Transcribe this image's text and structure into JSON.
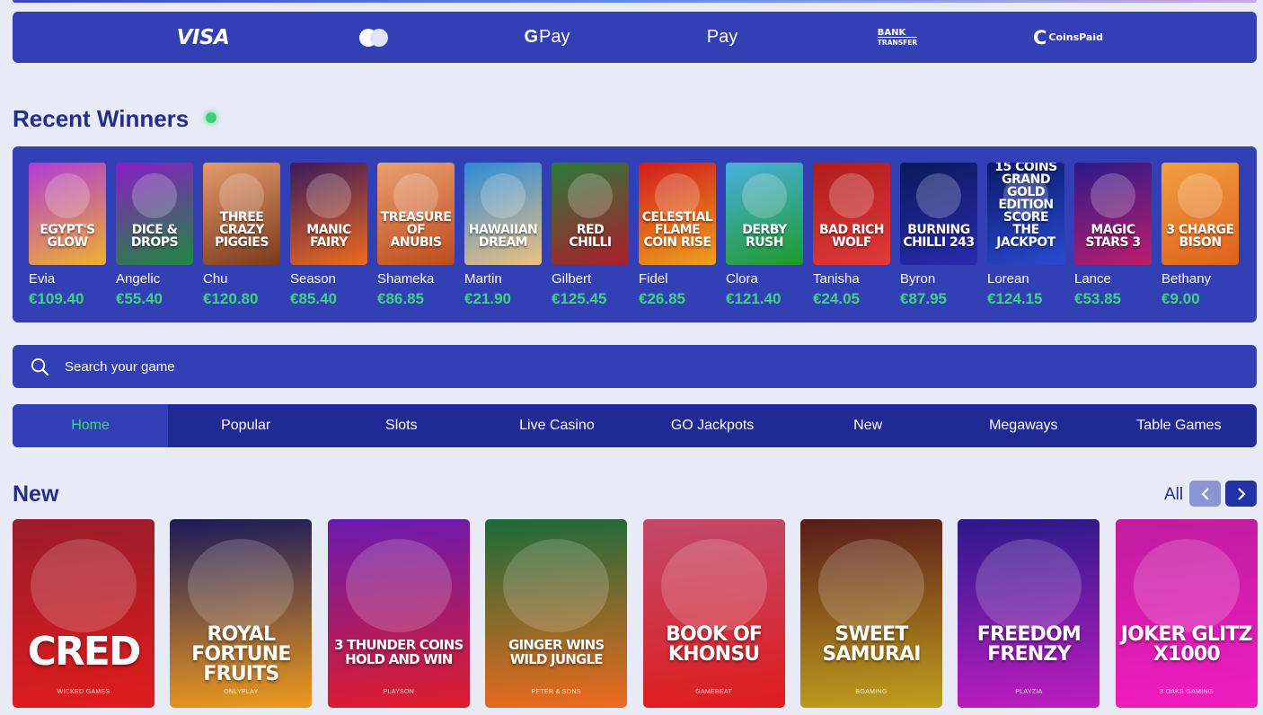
{
  "payments": {
    "visa": "VISA",
    "gpay_g": "G",
    "gpay_text": "Pay",
    "apple_glyph": "",
    "apay_text": "Pay",
    "bank_line1": "BANK",
    "bank_line2": "TRANSFER",
    "coinspaid_glyph": "C",
    "coinspaid_text": "CoinsPaid"
  },
  "recent_winners": {
    "title": "Recent Winners",
    "items": [
      {
        "game": "Egypt's Glow",
        "player": "Evia",
        "amount": "€109.40",
        "color_a": "#b03bd6",
        "color_b": "#f0b030"
      },
      {
        "game": "Dice & Drops",
        "player": "Angelic",
        "amount": "€55.40",
        "color_a": "#8a1cc9",
        "color_b": "#1f8a3b"
      },
      {
        "game": "Three Crazy Piggies",
        "player": "Chu",
        "amount": "€120.80",
        "color_a": "#e59a6a",
        "color_b": "#7a3a1c"
      },
      {
        "game": "Manic Fairy",
        "player": "Season",
        "amount": "€85.40",
        "color_a": "#3a1a5a",
        "color_b": "#f06a1c"
      },
      {
        "game": "Treasure of Anubis",
        "player": "Shameka",
        "amount": "€86.85",
        "color_a": "#e8a070",
        "color_b": "#c04a1c"
      },
      {
        "game": "Hawaiian Dream",
        "player": "Martin",
        "amount": "€21.90",
        "color_a": "#2a8ad8",
        "color_b": "#f0c080"
      },
      {
        "game": "Red Chilli",
        "player": "Gilbert",
        "amount": "€125.45",
        "color_a": "#2a7a3a",
        "color_b": "#b01c2a"
      },
      {
        "game": "Celestial Flame Coin Rise",
        "player": "Fidel",
        "amount": "€26.85",
        "color_a": "#d01c1c",
        "color_b": "#f0a01c"
      },
      {
        "game": "Derby Rush",
        "player": "Clora",
        "amount": "€121.40",
        "color_a": "#4ab0e0",
        "color_b": "#1f9a2a"
      },
      {
        "game": "Bad Rich Wolf",
        "player": "Tanisha",
        "amount": "€24.05",
        "color_a": "#b01c1c",
        "color_b": "#e03a3a"
      },
      {
        "game": "Burning Chilli 243",
        "player": "Byron",
        "amount": "€87.95",
        "color_a": "#0a1a5a",
        "color_b": "#2a2ab0"
      },
      {
        "game": "15 Coins Grand Gold Edition Score the Jackpot",
        "player": "Lorean",
        "amount": "€124.15",
        "color_a": "#0a1a6a",
        "color_b": "#2a4ad0"
      },
      {
        "game": "Magic Stars 3",
        "player": "Lance",
        "amount": "€53.85",
        "color_a": "#2a1a8a",
        "color_b": "#c01c6a"
      },
      {
        "game": "3 Charge Bison",
        "player": "Bethany",
        "amount": "€9.00",
        "color_a": "#f0a040",
        "color_b": "#e0601c"
      }
    ]
  },
  "search": {
    "placeholder": "Search your game"
  },
  "tabs": [
    "Home",
    "Popular",
    "Slots",
    "Live Casino",
    "GO Jackpots",
    "New",
    "Megaways",
    "Table Games"
  ],
  "new_section": {
    "title": "New",
    "all_label": "All",
    "games": [
      {
        "title": "Cred",
        "provider": "Wicked Games",
        "color_a": "#9a1c2a",
        "color_b": "#e01c1c",
        "size": "big"
      },
      {
        "title": "Royal Fortune Fruits",
        "provider": "OnlyPlay",
        "color_a": "#1a1a5a",
        "color_b": "#f09a1c",
        "size": "normal"
      },
      {
        "title": "3 Thunder Coins Hold and Win",
        "provider": "Playson",
        "color_a": "#6a1ab0",
        "color_b": "#e01c2a",
        "size": "small"
      },
      {
        "title": "Ginger Wins Wild Jungle",
        "provider": "Peter & Sons",
        "color_a": "#1a6a3a",
        "color_b": "#f06a1c",
        "size": "small"
      },
      {
        "title": "Book of Khonsu",
        "provider": "Gamebeat",
        "color_a": "#c04a6a",
        "color_b": "#e01c1c",
        "size": "normal"
      },
      {
        "title": "Sweet Samurai",
        "provider": "BGaming",
        "color_a": "#5a1a1a",
        "color_b": "#c0a01c",
        "size": "normal"
      },
      {
        "title": "Freedom Frenzy",
        "provider": "Playzia",
        "color_a": "#2a1a8a",
        "color_b": "#c01cc0",
        "size": "normal"
      },
      {
        "title": "Joker Glitz X1000",
        "provider": "3 Oaks Gaming",
        "color_a": "#c01ca0",
        "color_b": "#f01cc0",
        "size": "normal"
      }
    ]
  },
  "colors": {
    "panel": "#333fb4",
    "tabs_bg": "#1f2a94",
    "heading": "#222d8c",
    "win_amount": "#3fd47f",
    "live_dot": "#3bd07a"
  }
}
